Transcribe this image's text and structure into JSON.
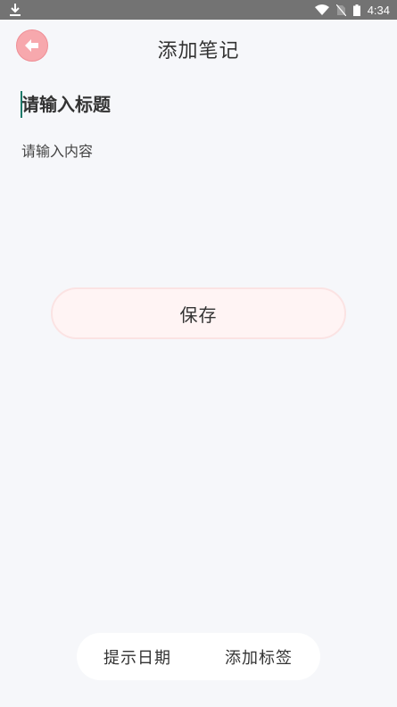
{
  "status_bar": {
    "time": "4:34",
    "icons": [
      "download-icon",
      "wifi-icon",
      "no-sim-icon",
      "battery-icon"
    ]
  },
  "header": {
    "title": "添加笔记",
    "back_icon": "arrow-left-icon"
  },
  "form": {
    "title_placeholder": "请输入标题",
    "content_placeholder": "请输入内容"
  },
  "actions": {
    "save_label": "保存"
  },
  "bottom_bar": {
    "remind_date_label": "提示日期",
    "add_tag_label": "添加标签"
  },
  "colors": {
    "accent": "#f7a8ad",
    "background": "#f6f7fa",
    "save_bg": "#fff4f4",
    "cursor": "#1e7a6a"
  }
}
